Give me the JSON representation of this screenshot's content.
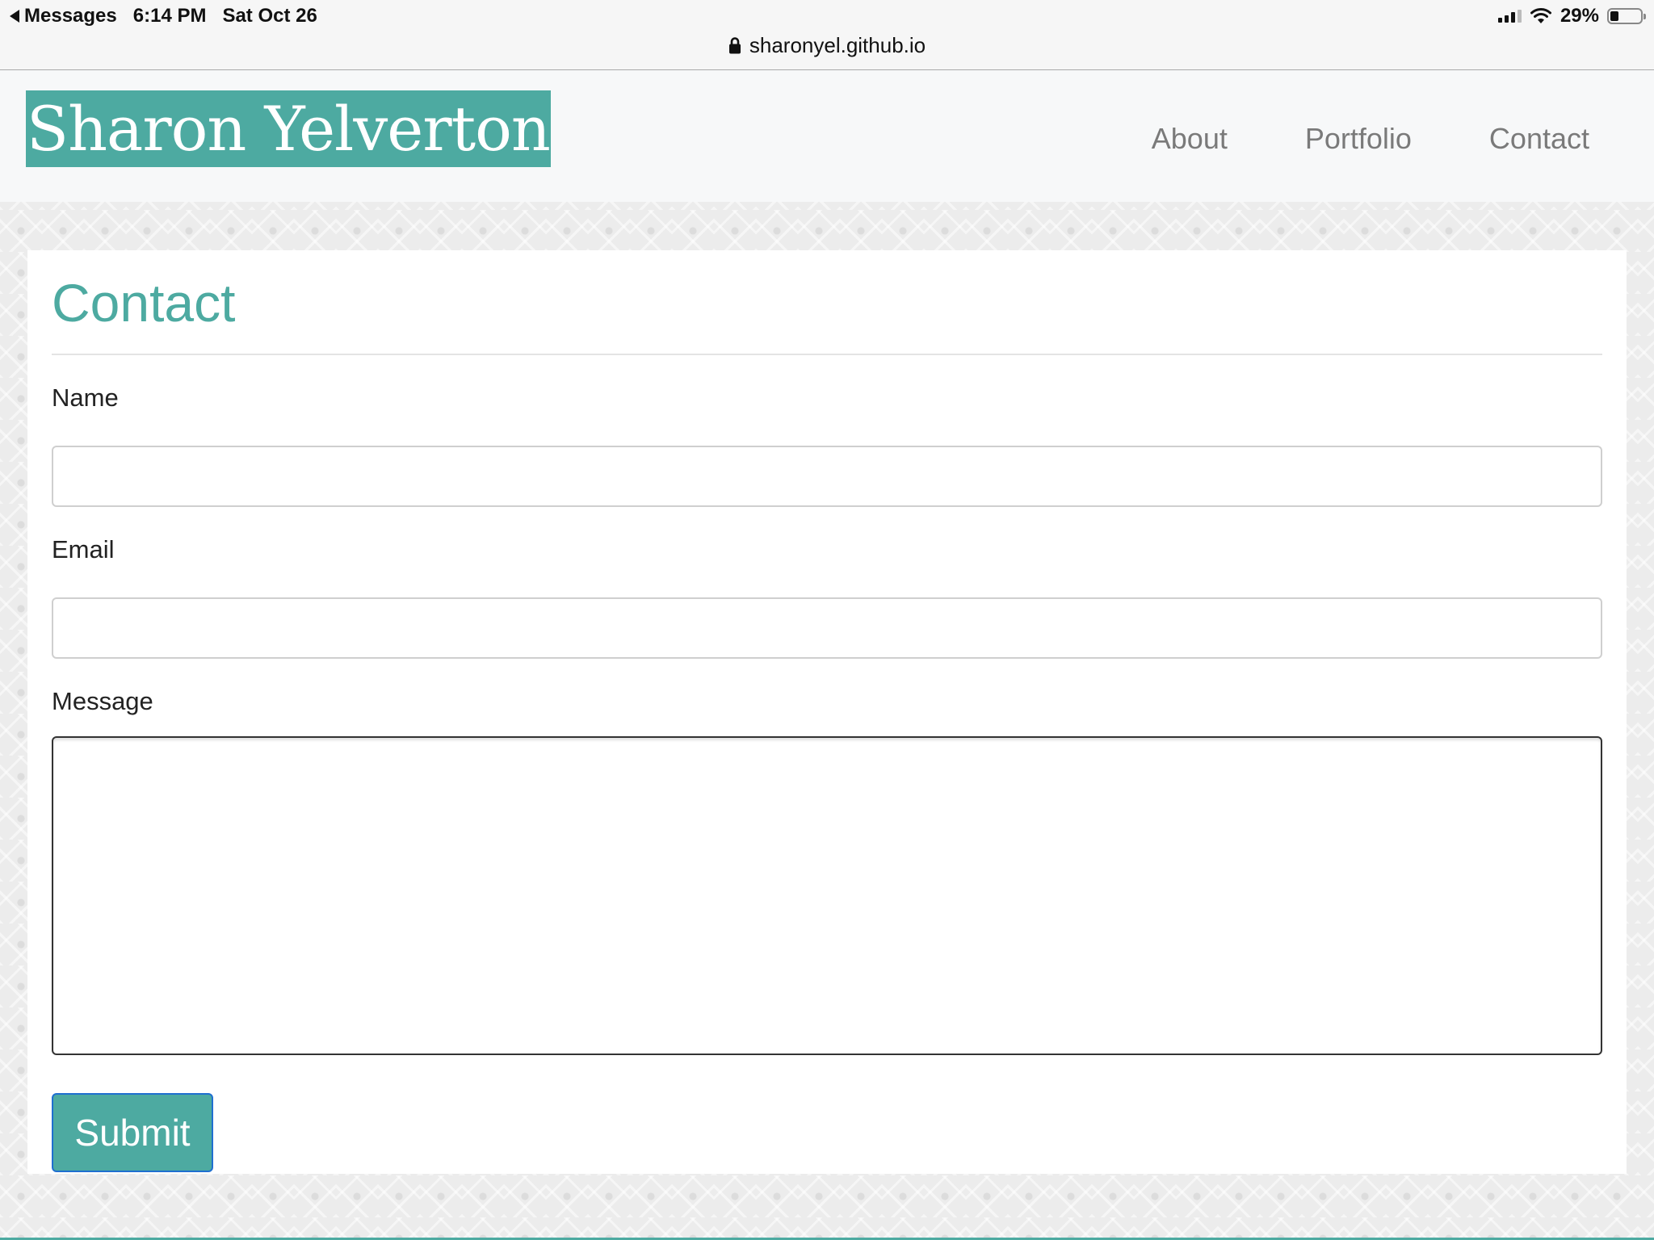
{
  "status_bar": {
    "back_app": "Messages",
    "time": "6:14 PM",
    "date": "Sat Oct 26",
    "battery": "29%",
    "battery_level": 0.29
  },
  "url_bar": {
    "domain": "sharonyel.github.io"
  },
  "nav": {
    "brand": "Sharon Yelverton",
    "links": [
      "About",
      "Portfolio",
      "Contact"
    ]
  },
  "contact": {
    "title": "Contact",
    "name_label": "Name",
    "name_value": "",
    "email_label": "Email",
    "email_value": "",
    "message_label": "Message",
    "message_value": "",
    "submit_label": "Submit"
  },
  "colors": {
    "accent": "#4daaa1",
    "nav_text": "#7a7a7a",
    "submit_border": "#1f6fd0"
  }
}
